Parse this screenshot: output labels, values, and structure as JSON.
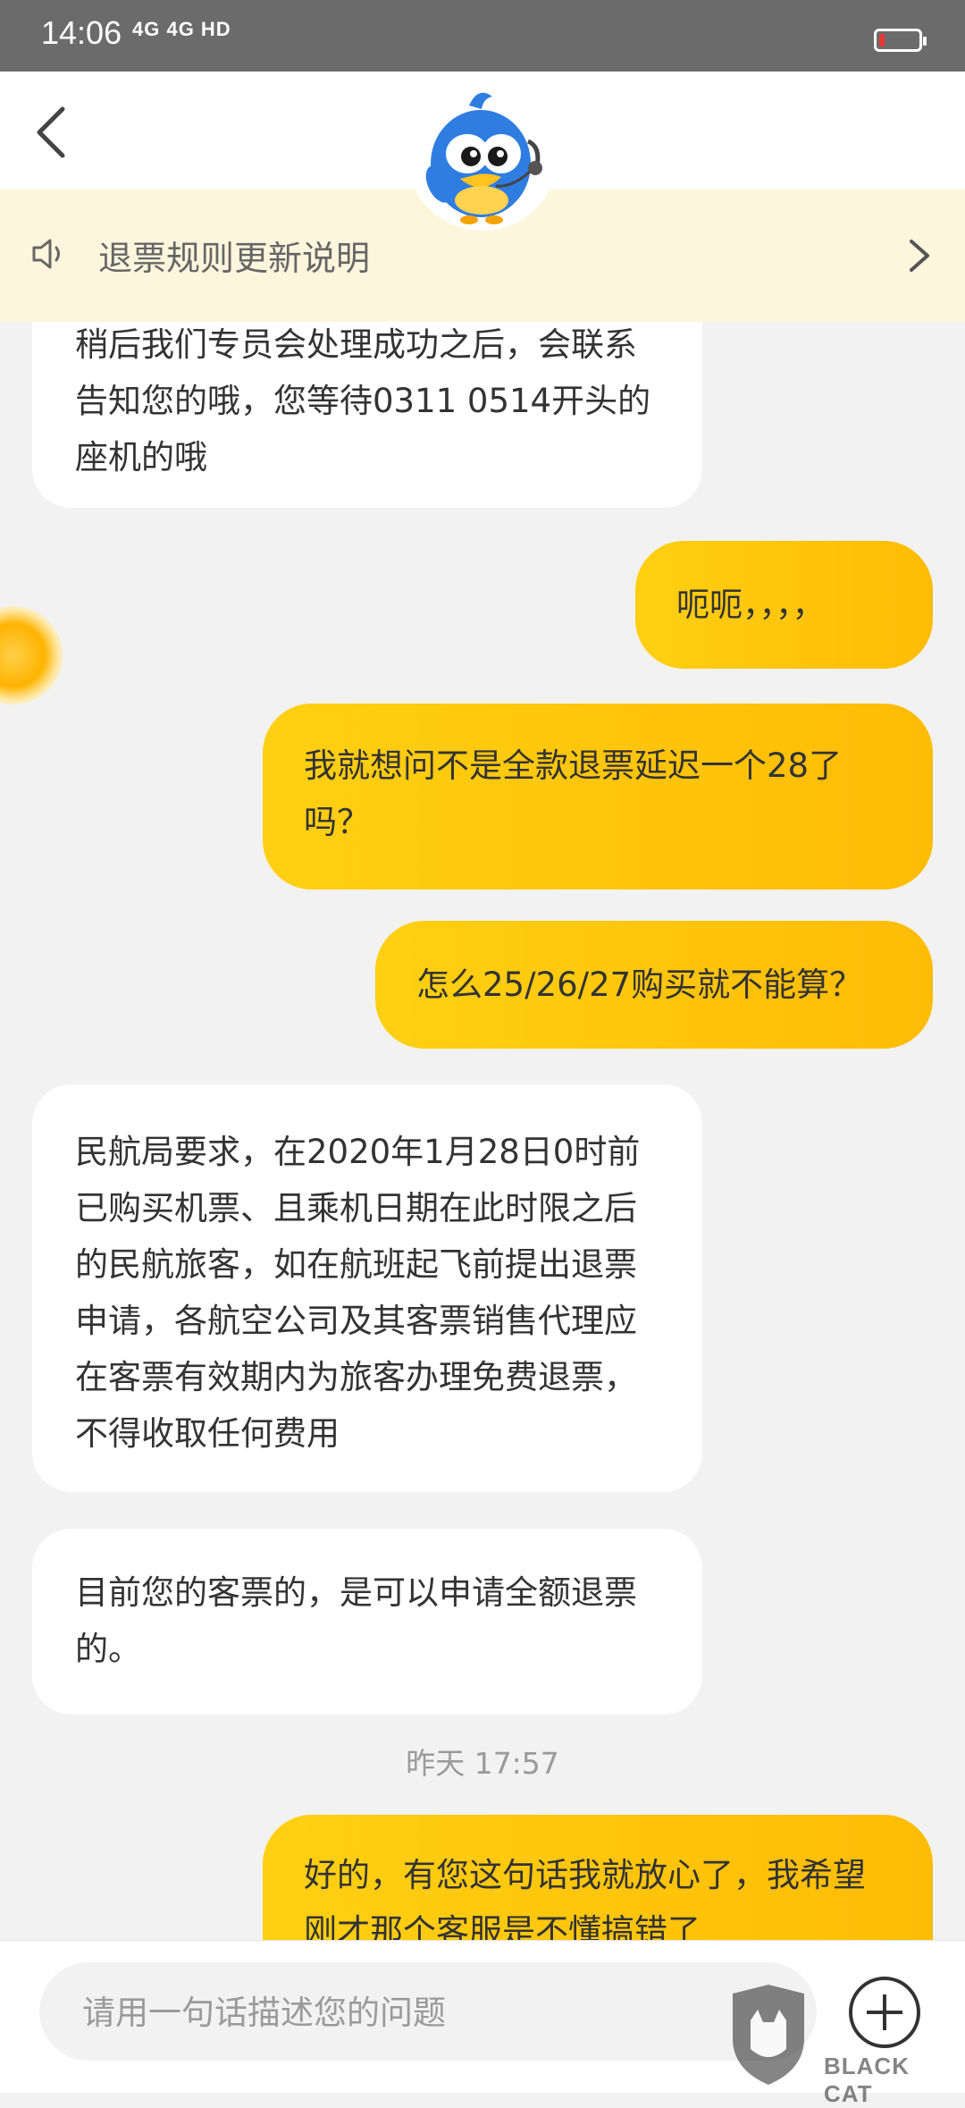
{
  "status_bar": {
    "time": "14:06",
    "signal_text": "4G 4G HD",
    "battery_color": "#e53935"
  },
  "header": {
    "back_icon": "chevron-left-icon",
    "avatar_icon": "bird-mascot-icon"
  },
  "notice": {
    "text": "退票规则更新说明",
    "icon": "speaker-icon",
    "arrow_icon": "chevron-right-icon"
  },
  "messages": [
    {
      "from": "agent",
      "text": "稍后我们专员会处理成功之后，会联系告知您的哦，您等待0311  0514开头的座机的哦"
    },
    {
      "from": "user",
      "text": "呃呃，，，，"
    },
    {
      "from": "user",
      "text": "我就想问不是全款退票延迟一个28了吗？"
    },
    {
      "from": "user",
      "text": "怎么25/26/27购买就不能算？"
    },
    {
      "from": "agent",
      "text": "民航局要求，在2020年1月28日0时前已购买机票、且乘机日期在此时限之后的民航旅客，如在航班起飞前提出退票申请，各航空公司及其客票销售代理应在客票有效期内为旅客办理免费退票，不得收取任何费用"
    },
    {
      "from": "agent",
      "text": "目前您的客票的，是可以申请全额退票的。"
    },
    {
      "from": "user",
      "text": "好的，有您这句话我就放心了，我希望刚才那个客服是不懂搞错了"
    }
  ],
  "timestamp": "昨天 17:57",
  "input": {
    "placeholder": "请用一句话描述您的问题",
    "value": "",
    "plus_icon": "plus-circle-icon"
  },
  "watermark": {
    "text": "BLACK CAT",
    "chars": "黑猫"
  },
  "colors": {
    "accent": "#ffc107",
    "notice_bg": "#fdf6dc",
    "chat_bg": "#f2f2f2"
  }
}
